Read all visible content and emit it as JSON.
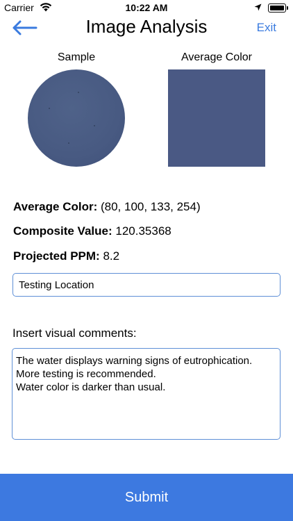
{
  "status_bar": {
    "carrier": "Carrier",
    "time": "10:22 AM"
  },
  "nav": {
    "title": "Image Analysis",
    "exit_label": "Exit",
    "accent_color": "#3a7bdf"
  },
  "images": {
    "sample_label": "Sample",
    "average_label": "Average Color",
    "sample_color": "#4b5c84",
    "average_color": "#4a5984"
  },
  "results": {
    "average_color_label": "Average Color:",
    "average_color_value": "(80, 100, 133, 254)",
    "composite_label": "Composite Value:",
    "composite_value": "120.35368",
    "ppm_label": "Projected PPM:",
    "ppm_value": "8.2"
  },
  "location": {
    "value": "Testing Location"
  },
  "comments": {
    "label": "Insert visual comments:",
    "lines": [
      "The water displays warning signs of eutrophication.",
      "More testing is recommended.",
      "Water color is darker than usual."
    ]
  },
  "submit": {
    "label": "Submit",
    "color": "#3d79e0"
  }
}
